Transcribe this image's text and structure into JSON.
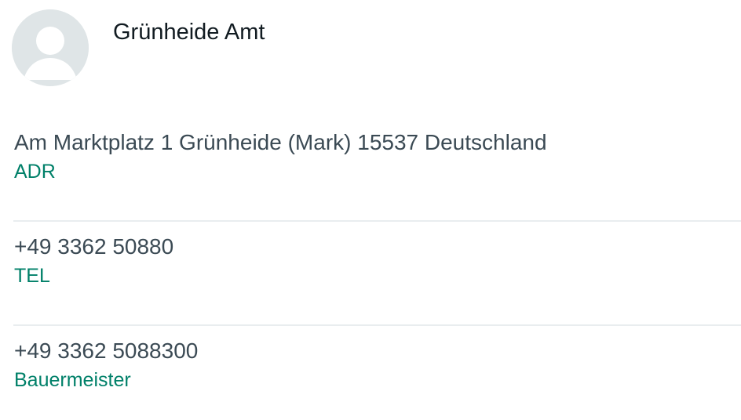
{
  "contact": {
    "name": "Grünheide Amt",
    "avatar_icon": "default-person-avatar-icon"
  },
  "fields": [
    {
      "value": "Am Marktplatz 1 Grünheide (Mark) 15537 Deutschland",
      "type": "ADR"
    },
    {
      "value": "+49 3362 50880",
      "type": "TEL"
    },
    {
      "value": "+49 3362 5088300",
      "type": "Bauermeister"
    }
  ],
  "colors": {
    "type_label": "#008069",
    "value_text": "#3b4a54",
    "divider": "#e9edef",
    "avatar_bg": "#dfe5e7"
  }
}
